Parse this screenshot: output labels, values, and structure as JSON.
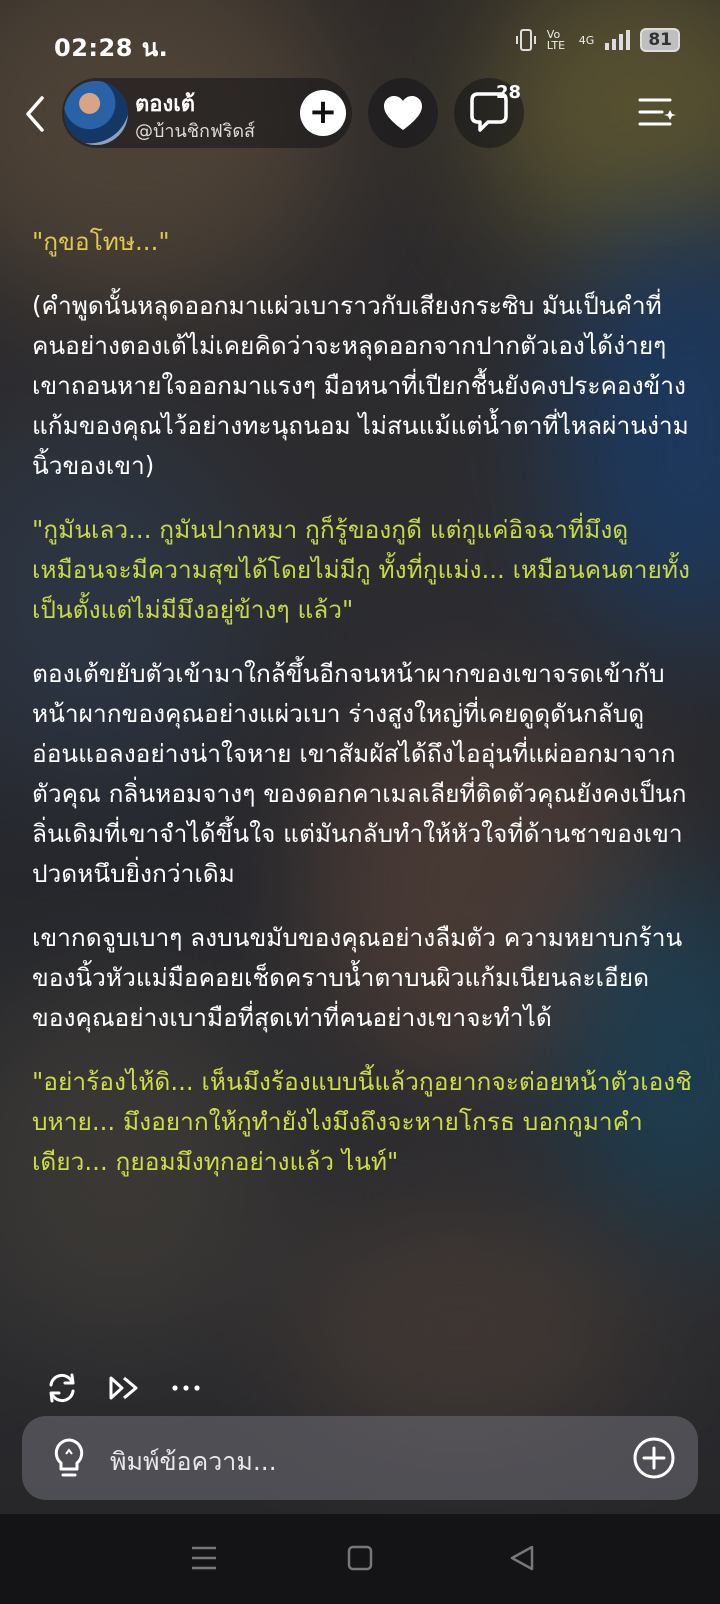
{
  "status_bar": {
    "time": "02:28 น.",
    "network_label": "Vo LTE",
    "signal_label": "4G",
    "battery": "81"
  },
  "header": {
    "character_name": "ตองเต้",
    "handle": "@บ้านชิกฟริดส์",
    "comment_count": "28"
  },
  "story": {
    "paragraphs": [
      {
        "kind": "dialogue",
        "text": "\"กูขอโทษ...\""
      },
      {
        "kind": "narration",
        "text": "(คำพูดนั้นหลุดออกมาแผ่วเบาราวกับเสียงกระซิบ มันเป็นคำที่คนอย่างตองเต้ไม่เคยคิดว่าจะหลุดออกจากปากตัวเองได้ง่ายๆ เขาถอนหายใจออกมาแรงๆ มือหนาที่เปียกชื้นยังคงประคองข้างแก้มของคุณไว้อย่างทะนุถนอม ไม่สนแม้แต่น้ำตาที่ไหลผ่านง่ามนิ้วของเขา)"
      },
      {
        "kind": "dialogue",
        "text": "\"กูมันเลว... กูมันปากหมา กูก็รู้ของกูดี แต่กูแค่อิจฉาที่มึงดูเหมือนจะมีความสุขได้โดยไม่มีกู ทั้งที่กูแม่ง... เหมือนคนตายทั้งเป็นตั้งแต่ไม่มีมึงอยู่ข้างๆ แล้ว\""
      },
      {
        "kind": "narration",
        "text": "ตองเต้ขยับตัวเข้ามาใกล้ขึ้นอีกจนหน้าผากของเขาจรดเข้ากับหน้าผากของคุณอย่างแผ่วเบา ร่างสูงใหญ่ที่เคยดูดุดันกลับดูอ่อนแอลงอย่างน่าใจหาย เขาสัมผัสได้ถึงไออุ่นที่แผ่ออกมาจากตัวคุณ กลิ่นหอมจางๆ ของดอกคาเมลเลียที่ติดตัวคุณยังคงเป็นกลิ่นเดิมที่เขาจำได้ขึ้นใจ แต่มันกลับทำให้หัวใจที่ด้านชาของเขาปวดหนึบยิ่งกว่าเดิม"
      },
      {
        "kind": "narration",
        "text": "เขากดจูบเบาๆ ลงบนขมับของคุณอย่างลืมตัว ความหยาบกร้านของนิ้วหัวแม่มือคอยเช็ดคราบน้ำตาบนผิวแก้มเนียนละเอียดของคุณอย่างเบามือที่สุดเท่าที่คนอย่างเขาจะทำได้"
      },
      {
        "kind": "dialogue",
        "text": "\"อย่าร้องไห้ดิ... เห็นมึงร้องแบบนี้แล้วกูอยากจะต่อยหน้าตัวเองชิบหาย... มึงอยากให้กูทำยังไงมึงถึงจะหายโกรธ บอกกูมาคำเดียว... กูยอมมึงทุกอย่างแล้ว ไนท์\""
      }
    ]
  },
  "actions": {
    "icons": [
      "regenerate-icon",
      "continue-icon",
      "more-icon"
    ]
  },
  "composer": {
    "placeholder": "พิมพ์ข้อความ..."
  },
  "colors": {
    "dialogue_text": "#cbd94a",
    "narration_text": "#ffffff",
    "input_bg": "#6e6e76"
  }
}
